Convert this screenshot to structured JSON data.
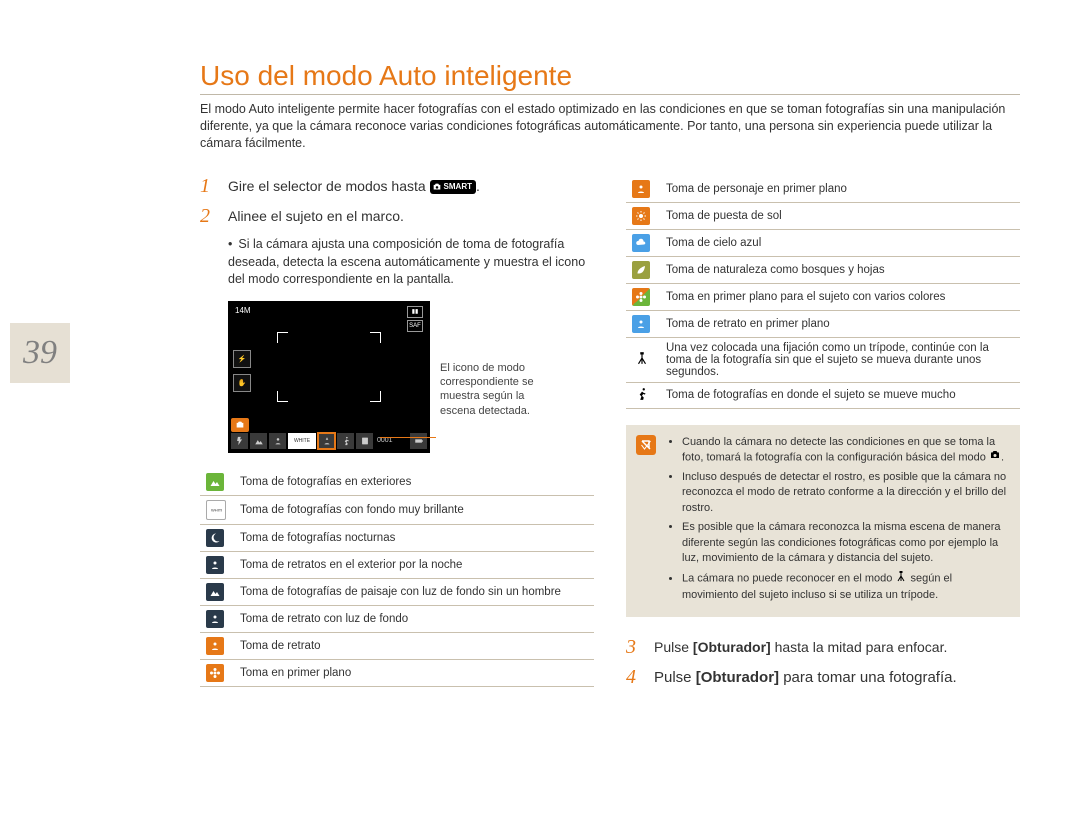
{
  "page_number": "39",
  "title": "Uso del modo Auto inteligente",
  "intro": "El modo Auto inteligente permite hacer fotografías con el estado optimizado en las condiciones en que se toman fotografías sin una manipulación diferente, ya que la cámara reconoce varias condiciones fotográficas automáticamente. Por tanto, una persona sin experiencia puede utilizar la cámara fácilmente.",
  "steps": {
    "s1": {
      "num": "1",
      "text_a": "Gire el selector de modos hasta ",
      "text_b": "."
    },
    "s2": {
      "num": "2",
      "text": "Alinee el sujeto en el marco."
    },
    "s2b": "Si la cámara ajusta una composición de toma de fotografía deseada, detecta la escena automáticamente y muestra el icono del modo correspondiente en la pantalla.",
    "s3": {
      "num": "3",
      "text_a": "Pulse ",
      "bold": "[Obturador]",
      "text_b": " hasta la mitad para enfocar."
    },
    "s4": {
      "num": "4",
      "text_a": "Pulse ",
      "bold": "[Obturador]",
      "text_b": " para tomar una fotografía."
    }
  },
  "smart_label": "SMART",
  "camera": {
    "resolution": "14M",
    "af": "SAF",
    "counter": "0001"
  },
  "callout": "El icono de modo correspondiente se muestra según la escena detectada.",
  "icons_left": [
    {
      "color": "green",
      "name": "landscape-icon",
      "label": "Toma de fotografías en exteriores"
    },
    {
      "color": "white",
      "name": "white-icon",
      "label": "Toma de fotografías con fondo muy brillante"
    },
    {
      "color": "dark",
      "name": "night-icon",
      "label": "Toma de fotografías nocturnas"
    },
    {
      "color": "dark",
      "name": "night-portrait-icon",
      "label": "Toma de retratos en el exterior por la noche"
    },
    {
      "color": "dark",
      "name": "backlight-landscape-icon",
      "label": "Toma de fotografías de paisaje con luz de fondo sin un hombre"
    },
    {
      "color": "dark",
      "name": "backlight-portrait-icon",
      "label": "Toma de retrato con luz de fondo"
    },
    {
      "color": "orange",
      "name": "portrait-icon",
      "label": "Toma de retrato"
    },
    {
      "color": "orange",
      "name": "macro-icon",
      "label": "Toma en primer plano"
    }
  ],
  "icons_right": [
    {
      "color": "orange",
      "name": "macro-portrait-icon",
      "label": "Toma de personaje en primer plano"
    },
    {
      "color": "orange",
      "name": "sunset-icon",
      "label": "Toma de puesta de sol"
    },
    {
      "color": "blue",
      "name": "bluesky-icon",
      "label": "Toma de cielo azul"
    },
    {
      "color": "oliv",
      "name": "nature-icon",
      "label": "Toma de naturaleza como bosques y hojas"
    },
    {
      "color": "mix",
      "name": "macro-color-icon",
      "label": "Toma en primer plano para el sujeto con varios colores"
    },
    {
      "color": "blue",
      "name": "closeup-portrait-icon",
      "label": "Toma de retrato en primer plano"
    },
    {
      "plain": "tripod",
      "name": "tripod-icon",
      "label": "Una vez colocada una fijación como un trípode, continúe con la toma de la fotografía sin que el sujeto se mueva durante unos segundos."
    },
    {
      "plain": "run",
      "name": "motion-icon",
      "label": "Toma de fotografías en donde el sujeto se mueve mucho"
    }
  ],
  "notes": [
    "Cuando la cámara no detecte las condiciones en que se toma la foto, tomará la fotografía con la configuración básica del modo ",
    "Incluso después de detectar el rostro, es posible que la cámara no reconozca el modo de retrato conforme a la dirección y el brillo del rostro.",
    "Es posible que la cámara reconozca la misma escena de manera diferente según las condiciones fotográficas como por ejemplo la luz, movimiento de la cámara y distancia del sujeto.",
    "La cámara no puede reconocer en el modo  según el movimiento del sujeto incluso si se utiliza un trípode."
  ],
  "notes_tail": {
    "n1_suffix": ".",
    "n4_prefix": "La cámara no puede reconocer en el modo ",
    "n4_suffix": " según el movimiento del sujeto incluso si se utiliza un trípode."
  }
}
